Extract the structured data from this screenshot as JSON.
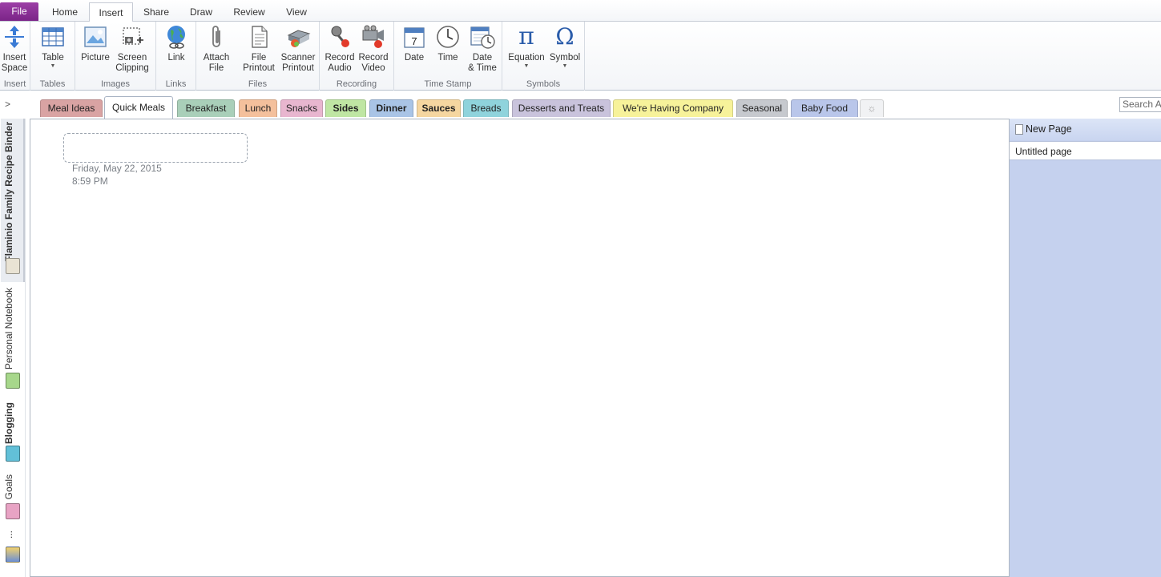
{
  "ribbon_tabs": {
    "file": "File",
    "home": "Home",
    "insert": "Insert",
    "share": "Share",
    "draw": "Draw",
    "review": "Review",
    "view": "View",
    "active": "Insert"
  },
  "ribbon": {
    "groups": {
      "insert": "Insert",
      "tables": "Tables",
      "images": "Images",
      "links": "Links",
      "files": "Files",
      "recording": "Recording",
      "timestamp": "Time Stamp",
      "symbols": "Symbols"
    },
    "buttons": {
      "insert_space": [
        "Insert",
        "Space"
      ],
      "table": "Table",
      "picture": "Picture",
      "screen_clipping": [
        "Screen",
        "Clipping"
      ],
      "link": "Link",
      "attach_file": [
        "Attach",
        "File"
      ],
      "file_printout": [
        "File",
        "Printout"
      ],
      "scanner_printout": [
        "Scanner",
        "Printout"
      ],
      "record_audio": [
        "Record",
        "Audio"
      ],
      "record_video": [
        "Record",
        "Video"
      ],
      "date": "Date",
      "time": "Time",
      "date_time": [
        "Date",
        "& Time"
      ],
      "equation": "Equation",
      "symbol": "Symbol"
    },
    "icons": {
      "insert_space": "insert-space-icon",
      "equation_glyph": "π",
      "symbol_glyph": "Ω",
      "calendar_day": "7"
    }
  },
  "sections": {
    "tabs": [
      {
        "label": "Meal Ideas",
        "color": "#d9a3a3",
        "bold": false
      },
      {
        "label": "Quick Meals",
        "color": "#ffffff",
        "bold": false
      },
      {
        "label": "Breakfast",
        "color": "#a9cfb9",
        "bold": false
      },
      {
        "label": "Lunch",
        "color": "#f4c09c",
        "bold": false
      },
      {
        "label": "Snacks",
        "color": "#e8b6cf",
        "bold": false
      },
      {
        "label": "Sides",
        "color": "#bfe6a3",
        "bold": true
      },
      {
        "label": "Dinner",
        "color": "#a9c4e6",
        "bold": true
      },
      {
        "label": "Sauces",
        "color": "#f5d6a0",
        "bold": true
      },
      {
        "label": "Breads",
        "color": "#8fd3dc",
        "bold": false
      },
      {
        "label": "Desserts and Treats",
        "color": "#c9c3dc",
        "bold": false
      },
      {
        "label": "We're Having Company",
        "color": "#f7f29a",
        "bold": false
      },
      {
        "label": "Seasonal",
        "color": "#c6c9ce",
        "bold": false
      },
      {
        "label": "Baby Food",
        "color": "#b9c6ea",
        "bold": false
      }
    ],
    "active": "Quick Meals",
    "add_tab_icon": "new-section-icon",
    "search_placeholder": "Search All"
  },
  "notebooks": {
    "items": [
      {
        "label": "Flaminio Family Recipe Binder",
        "color": "#e9e3d4",
        "active": true,
        "bold": true
      },
      {
        "label": "Personal Notebook",
        "color": "#a7d78b",
        "active": false,
        "bold": false
      },
      {
        "label": "Blogging",
        "color": "#62c0d8",
        "active": false,
        "bold": true
      },
      {
        "label": "Goals",
        "color": "#e8a3c4",
        "active": false,
        "bold": false
      }
    ],
    "more": "...",
    "collapse_glyph": ">"
  },
  "page": {
    "date": "Friday, May 22, 2015",
    "time": "8:59 PM"
  },
  "pagelist": {
    "new_page": "New Page",
    "pages": [
      "Untitled page"
    ]
  }
}
